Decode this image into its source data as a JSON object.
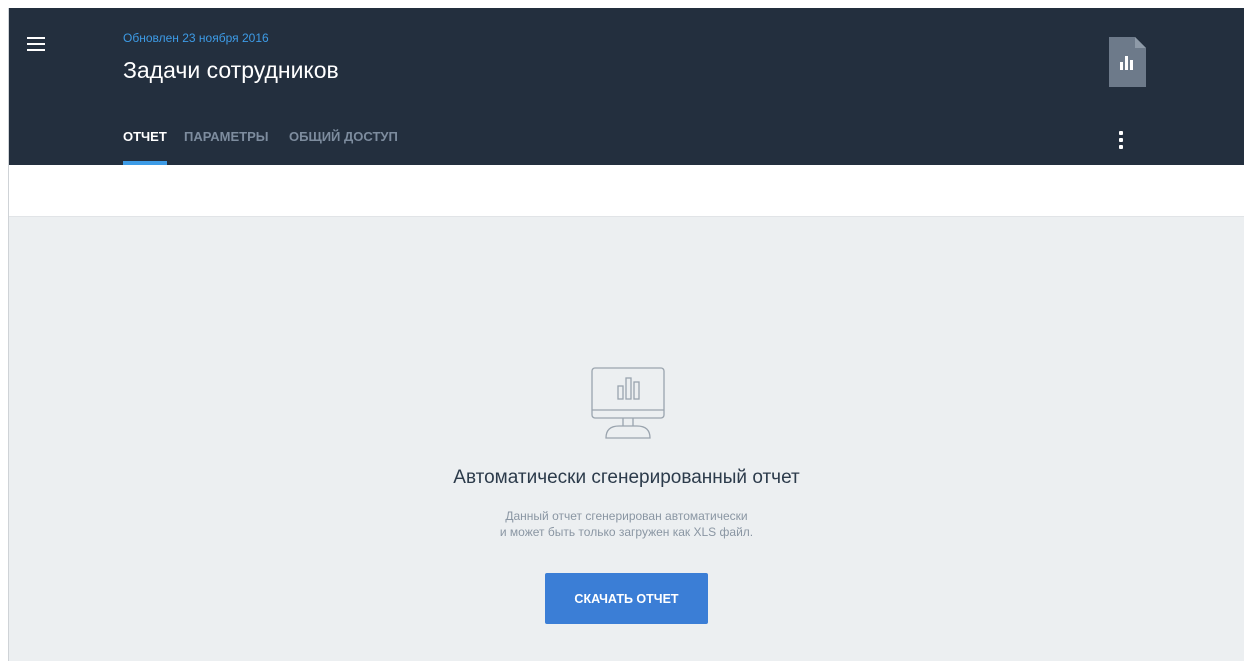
{
  "header": {
    "updated": "Обновлен 23 ноября 2016",
    "title": "Задачи сотрудников",
    "menu_icon": "hamburger-menu-icon",
    "file_icon": "report-file-icon",
    "more_icon": "more-vertical-icon"
  },
  "tabs": [
    {
      "label": "ОТЧЕТ",
      "active": true
    },
    {
      "label": "ПАРАМЕТРЫ",
      "active": false
    },
    {
      "label": "ОБЩИЙ ДОСТУП",
      "active": false
    }
  ],
  "empty_state": {
    "icon": "monitor-chart-icon",
    "title": "Автоматически сгенерированный отчет",
    "desc_line1": "Данный отчет сгенерирован автоматически",
    "desc_line2": "и может быть только загружен как XLS файл.",
    "button_label": "СКАЧАТЬ ОТЧЕТ"
  },
  "colors": {
    "header_bg": "#232f3e",
    "accent": "#3d9be6",
    "button": "#3b7ed6",
    "content_bg": "#eceff1"
  }
}
